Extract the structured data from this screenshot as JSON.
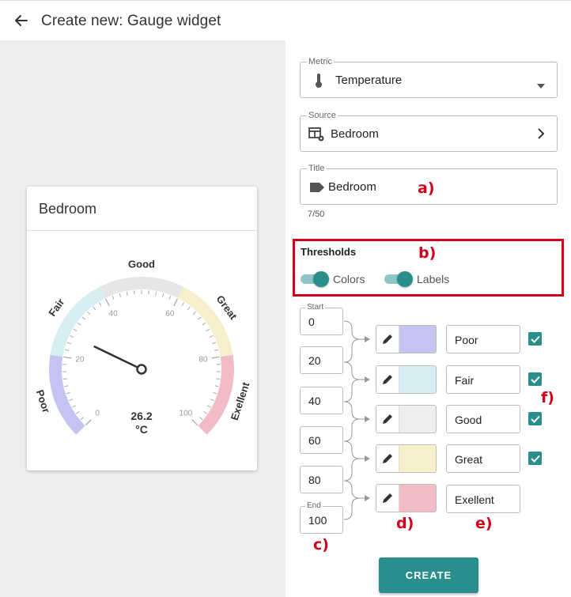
{
  "header": {
    "title": "Create new: Gauge widget",
    "back_icon": "arrow-left-icon"
  },
  "preview": {
    "card_title": "Bedroom",
    "gauge": {
      "value": 26.2,
      "value_text": "26.2",
      "unit": "°C",
      "min": 0,
      "max": 100,
      "tick_labels": [
        "0",
        "20",
        "40",
        "60",
        "80",
        "100"
      ],
      "bands": [
        {
          "from": 0,
          "to": 20,
          "label": "Poor",
          "color": "#c5c3f2"
        },
        {
          "from": 20,
          "to": 40,
          "label": "Fair",
          "color": "#d6eef4"
        },
        {
          "from": 40,
          "to": 60,
          "label": "Good",
          "color": "#e6e6e6"
        },
        {
          "from": 60,
          "to": 80,
          "label": "Great",
          "color": "#f7efcc"
        },
        {
          "from": 80,
          "to": 100,
          "label": "Exellent",
          "color": "#f1bcc6"
        }
      ]
    }
  },
  "form": {
    "metric": {
      "legend": "Metric",
      "value": "Temperature",
      "icon": "thermometer-icon"
    },
    "source": {
      "legend": "Source",
      "value": "Bedroom",
      "icon": "table-settings-icon"
    },
    "title": {
      "legend": "Title",
      "value": "Bedroom",
      "icon": "label-tag-icon",
      "counter": "7/50"
    },
    "thresholds": {
      "heading": "Thresholds",
      "colors_toggle": {
        "label": "Colors",
        "on": true
      },
      "labels_toggle": {
        "label": "Labels",
        "on": true
      }
    },
    "bounds": {
      "start_legend": "Start",
      "end_legend": "End",
      "values": [
        "0",
        "20",
        "40",
        "60",
        "80",
        "100"
      ]
    },
    "ranges": [
      {
        "label": "Poor",
        "color": "#c5c3f2",
        "checked": true
      },
      {
        "label": "Fair",
        "color": "#d6eef4",
        "checked": true
      },
      {
        "label": "Good",
        "color": "#eeeeee",
        "checked": true
      },
      {
        "label": "Great",
        "color": "#f7efcc",
        "checked": true
      },
      {
        "label": "Exellent",
        "color": "#f1bcc6",
        "checked": false
      }
    ],
    "create_label": "CREATE"
  },
  "annotations": {
    "a": "a)",
    "b": "b)",
    "c": "c)",
    "d": "d)",
    "e": "e)",
    "f": "f)",
    "color": "#d0021b"
  },
  "colors": {
    "accent": "#2a8e8d",
    "accent_light": "#8fc6c5",
    "preview_background": "#eeeeee"
  }
}
